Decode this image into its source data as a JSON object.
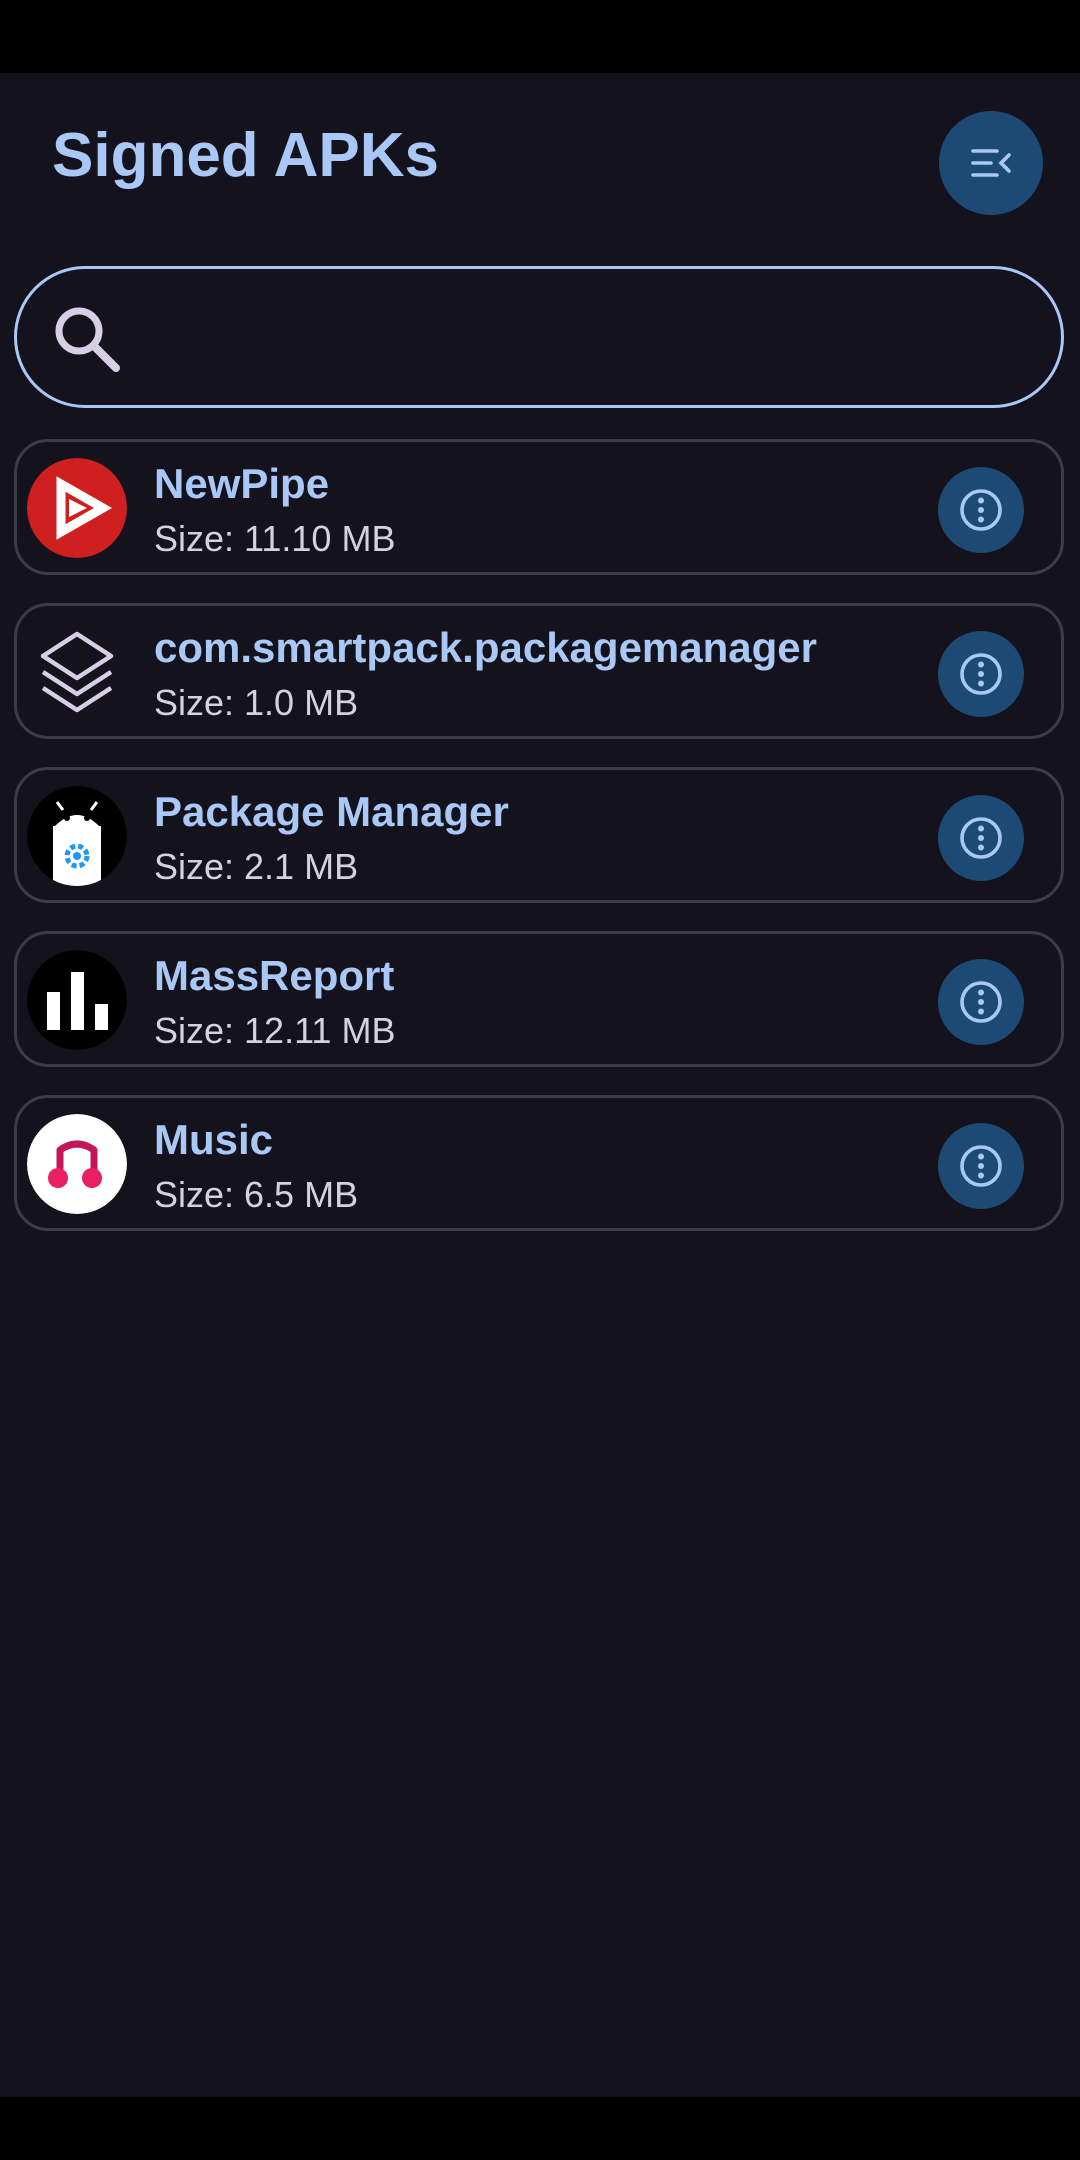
{
  "header": {
    "title": "Signed APKs",
    "menu_icon": "collapse-menu-icon"
  },
  "search": {
    "value": "",
    "icon": "search-icon"
  },
  "apks": [
    {
      "name": "NewPipe",
      "size": "Size: 11.10 MB",
      "icon": "newpipe-icon"
    },
    {
      "name": "com.smartpack.packagemanager",
      "size": "Size: 1.0 MB",
      "icon": "layers-icon"
    },
    {
      "name": "Package Manager",
      "size": "Size: 2.1 MB",
      "icon": "package-manager-icon"
    },
    {
      "name": "MassReport",
      "size": "Size: 12.11 MB",
      "icon": "massreport-icon"
    },
    {
      "name": "Music",
      "size": "Size: 6.5 MB",
      "icon": "music-icon"
    }
  ],
  "colors": {
    "background": "#14131d",
    "accent_text": "#a9c8f6",
    "button_fill": "#1d4a74",
    "card_border": "#3d3c46"
  }
}
